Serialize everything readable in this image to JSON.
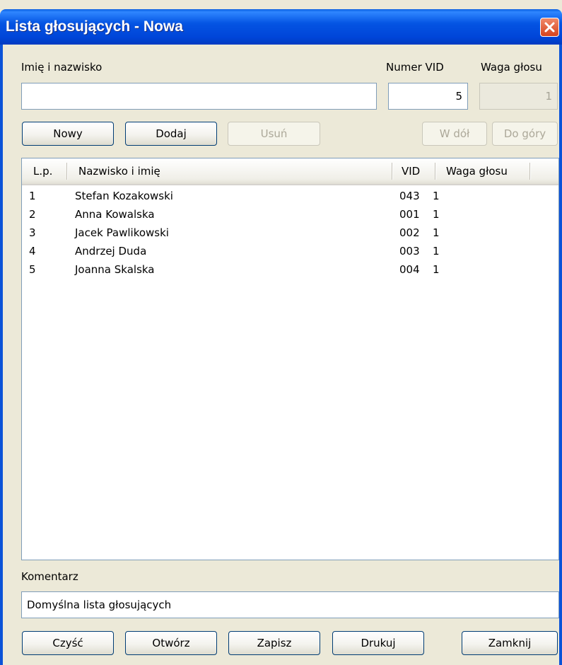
{
  "window": {
    "title": "Lista głosujących - Nowa"
  },
  "form": {
    "name_label": "Imię i nazwisko",
    "name_value": "",
    "vid_label": "Numer VID",
    "vid_value": "5",
    "weight_label": "Waga głosu",
    "weight_value": "1"
  },
  "actions": {
    "new": "Nowy",
    "add": "Dodaj",
    "remove": "Usuń",
    "down": "W dół",
    "up": "Do góry"
  },
  "table": {
    "columns": [
      "L.p.",
      "Nazwisko i imię",
      "VID",
      "Waga głosu"
    ],
    "rows": [
      [
        "1",
        "Stefan Kozakowski",
        "043",
        "1"
      ],
      [
        "2",
        "Anna Kowalska",
        "001",
        "1"
      ],
      [
        "3",
        "Jacek Pawlikowski",
        "002",
        "1"
      ],
      [
        "4",
        "Andrzej Duda",
        "003",
        "1"
      ],
      [
        "5",
        "Joanna Skalska",
        "004",
        "1"
      ]
    ]
  },
  "comment": {
    "label": "Komentarz",
    "value": "Domyślna lista głosujących"
  },
  "footer": {
    "clear": "Czyść",
    "open": "Otwórz",
    "save": "Zapisz",
    "print": "Drukuj",
    "close": "Zamknij"
  },
  "colors": {
    "titlebar": "#0454e3",
    "window_bg": "#ece9d8",
    "button_border": "#003c74",
    "close_button": "#d5431e"
  }
}
